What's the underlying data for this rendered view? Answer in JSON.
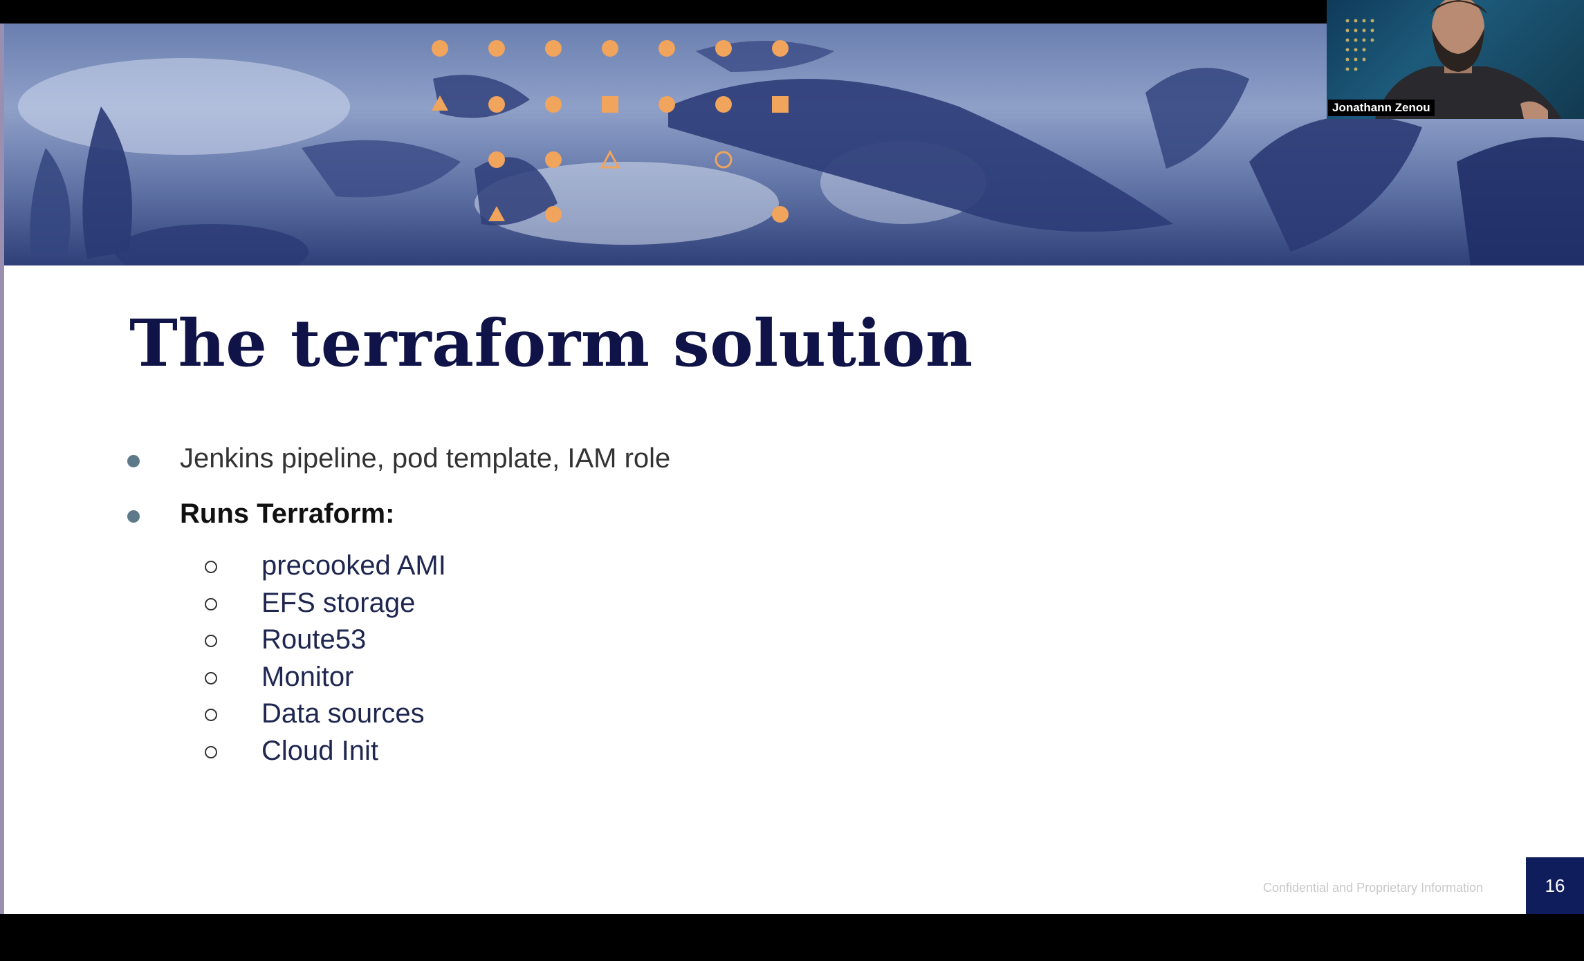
{
  "slide": {
    "title": "The terraform solution",
    "bullets": [
      {
        "text": "Jenkins pipeline,  pod template, IAM role",
        "bold": false
      },
      {
        "text": "Runs Terraform:",
        "bold": true
      }
    ],
    "sub_bullets": [
      "precooked AMI",
      "EFS storage",
      "Route53",
      "Monitor",
      "Data sources",
      "Cloud Init"
    ],
    "footer": "Confidential and Proprietary Information",
    "page_number": "16",
    "banner_image": "sea-lions-underwater-photo",
    "colors": {
      "title": "#0f1347",
      "bullet_dot": "#5e7a8a",
      "page_badge": "#0f1d5c",
      "shape_accent": "#f0a45c"
    }
  },
  "video_call": {
    "participant_name": "Jonathann Zenou"
  }
}
